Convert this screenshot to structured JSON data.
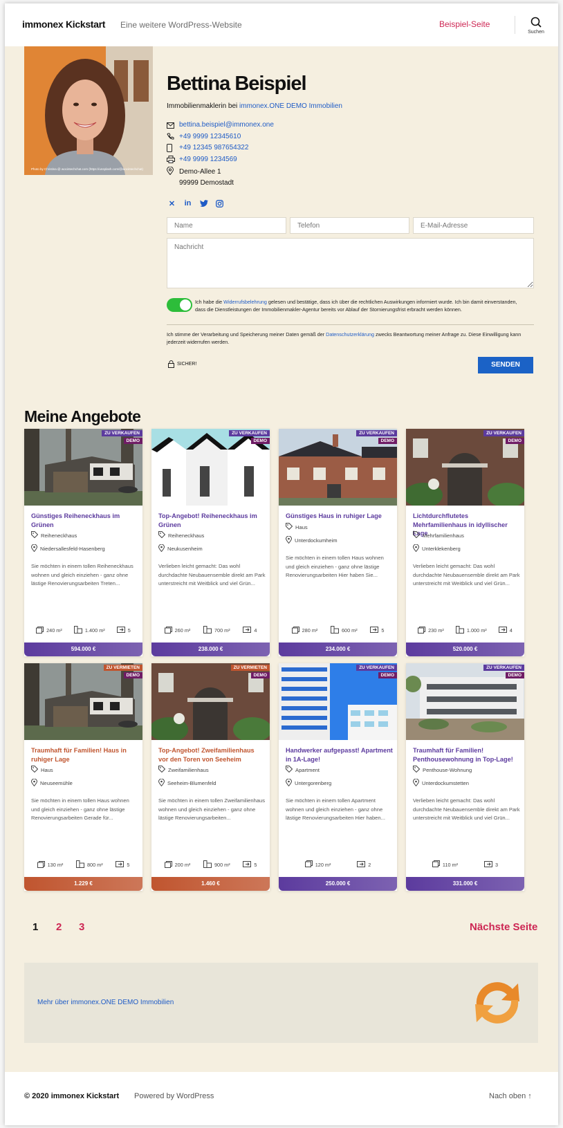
{
  "header": {
    "site_title": "immonex Kickstart",
    "site_description": "Eine weitere WordPress-Website",
    "nav_link": "Beispiel-Seite",
    "search_label": "Suchen"
  },
  "agent": {
    "name": "Bettina Beispiel",
    "position_prefix": "Immobilienmaklerin bei ",
    "company": "immonex.ONE DEMO Immobilien",
    "photo_credit": "Photo by Christina @ wocintechchat.com (https://unsplash.com/@wocintechchat)",
    "email": "bettina.beispiel@immonex.one",
    "phone": "+49 9999 12345610",
    "mobile": "+49 12345 987654322",
    "fax": "+49 9999 1234569",
    "street": "Demo-Allee 1",
    "city": "99999 Demostadt",
    "socials": [
      "xing-icon",
      "linkedin-icon",
      "twitter-icon",
      "instagram-icon"
    ]
  },
  "form": {
    "name_placeholder": "Name",
    "phone_placeholder": "Telefon",
    "email_placeholder": "E-Mail-Adresse",
    "message_placeholder": "Nachricht",
    "consent1_pre": "Ich habe die ",
    "consent1_link": "Widerrufsbelehrung",
    "consent1_post": " gelesen und bestätige, dass ich über die rechtlichen Auswirkungen informiert wurde. Ich bin damit einverstanden, dass die Dienstleistungen der Immobilienmakler-Agentur bereits vor Ablauf der Stornierungsfrist erbracht werden können.",
    "consent1_checked": true,
    "consent2_pre": "Ich stimme der Verarbeitung und Speicherung meiner Daten gemäß der ",
    "consent2_link": "Datenschutzerklärung",
    "consent2_post": " zwecks Beantwortung meiner Anfrage zu. Diese Einwilligung kann jederzeit widerrufen werden.",
    "secure_label": "SICHER!",
    "submit_label": "SENDEN"
  },
  "listings": {
    "title": "Meine Angebote",
    "cards": [
      {
        "marketing": "ZU VERKAUFEN",
        "demo": "DEMO",
        "title": "Günstiges Reiheneckhaus im Grünen",
        "type": "Reiheneckhaus",
        "location": "Niedersallesfeld-Hasenberg",
        "desc": "Sie möchten in einem tollen Reiheneckhaus wohnen und gleich einziehen - ganz ohne lästige Renovierungsarbeiten Treten...",
        "area": "240 m²",
        "plot": "1.400 m²",
        "rooms": "5",
        "price": "594.000 €",
        "accent": "#5c3b9e",
        "img": "forest"
      },
      {
        "marketing": "ZU VERKAUFEN",
        "demo": "DEMO",
        "title": "Top-Angebot! Reiheneckhaus im Grünen",
        "type": "Reiheneckhaus",
        "location": "Neukusenheim",
        "desc": "Verlieben leicht gemacht: Das wohl durchdachte Neubauensemble direkt am Park unterstreicht mit Weitblick und viel Grün...",
        "area": "260 m²",
        "plot": "700 m²",
        "rooms": "4",
        "price": "238.000 €",
        "accent": "#5c3b9e",
        "img": "modern"
      },
      {
        "marketing": "ZU VERKAUFEN",
        "demo": "DEMO",
        "title": "Günstiges Haus in ruhiger Lage",
        "type": "Haus",
        "location": "Unterdockumheim",
        "desc": "Sie möchten in einem tollen Haus wohnen und gleich einziehen - ganz ohne lästige Renovierungsarbeiten Hier haben Sie...",
        "area": "280 m²",
        "plot": "600 m²",
        "rooms": "5",
        "price": "234.000 €",
        "accent": "#5c3b9e",
        "img": "brick"
      },
      {
        "marketing": "ZU VERKAUFEN",
        "demo": "DEMO",
        "title": "Lichtdurchflutetes Mehrfamilienhaus in idyllischer Lage",
        "type": "Mehrfamilienhaus",
        "location": "Unterklekenberg",
        "desc": "Verlieben leicht gemacht: Das wohl durchdachte Neubauensemble direkt am Park unterstreicht mit Weitblick und viel Grün...",
        "area": "230 m²",
        "plot": "1.000 m²",
        "rooms": "4",
        "price": "520.000 €",
        "accent": "#5c3b9e",
        "img": "garden"
      },
      {
        "marketing": "ZU VERMIETEN",
        "demo": "DEMO",
        "title": "Traumhaft für Familien! Haus in ruhiger Lage",
        "type": "Haus",
        "location": "Neuseemühle",
        "desc": "Sie möchten in einem tollen Haus wohnen und gleich einziehen - ganz ohne lästige Renovierungsarbeiten Gerade für...",
        "area": "130 m²",
        "plot": "800 m²",
        "rooms": "5",
        "price": "1.229 €",
        "accent": "#c0552f",
        "img": "forest"
      },
      {
        "marketing": "ZU VERMIETEN",
        "demo": "DEMO",
        "title": "Top-Angebot! Zweifamilienhaus vor den Toren von Seeheim",
        "type": "Zweifamilienhaus",
        "location": "Seeheim-Blumenfeld",
        "desc": "Sie möchten in einem tollen Zweifamilienhaus wohnen und gleich einziehen - ganz ohne lästige Renovierungsarbeiten...",
        "area": "200 m²",
        "plot": "900 m²",
        "rooms": "5",
        "price": "1.460 €",
        "accent": "#c0552f",
        "img": "garden"
      },
      {
        "marketing": "ZU VERKAUFEN",
        "demo": "DEMO",
        "title": "Handwerker aufgepasst! Apartment in 1A-Lage!",
        "type": "Apartment",
        "location": "Untergorenberg",
        "desc": "Sie möchten in einem tollen Apartment wohnen und gleich einziehen - ganz ohne lästige Renovierungsarbeiten Hier haben...",
        "area": "120 m²",
        "plot": "",
        "rooms": "2",
        "price": "250.000 €",
        "accent": "#5c3b9e",
        "img": "tower"
      },
      {
        "marketing": "ZU VERKAUFEN",
        "demo": "DEMO",
        "title": "Traumhaft für Familien! Penthousewohnung in Top-Lage!",
        "type": "Penthouse-Wohnung",
        "location": "Unterdockumstetten",
        "desc": "Verlieben leicht gemacht: Das wohl durchdachte Neubauensemble direkt am Park unterstreicht mit Weitblick und viel Grün...",
        "area": "110 m²",
        "plot": "",
        "rooms": "3",
        "price": "331.000 €",
        "accent": "#5c3b9e",
        "img": "terrace"
      }
    ]
  },
  "pagination": {
    "pages": [
      "1",
      "2",
      "3"
    ],
    "current": "1",
    "next_label": "Nächste Seite"
  },
  "about": {
    "link_label": "Mehr über immonex.ONE DEMO Immobilien"
  },
  "footer": {
    "copyright": "© 2020 immonex Kickstart",
    "powered": "Powered by WordPress",
    "to_top": "Nach oben ↑"
  },
  "colors": {
    "accent_red": "#cd2653",
    "link_blue": "#1e5bc6",
    "sale_purple": "#5c3b9e",
    "rent_orange": "#c0552f",
    "toggle_green": "#2dbd3a",
    "page_bg": "#f5efe0"
  }
}
